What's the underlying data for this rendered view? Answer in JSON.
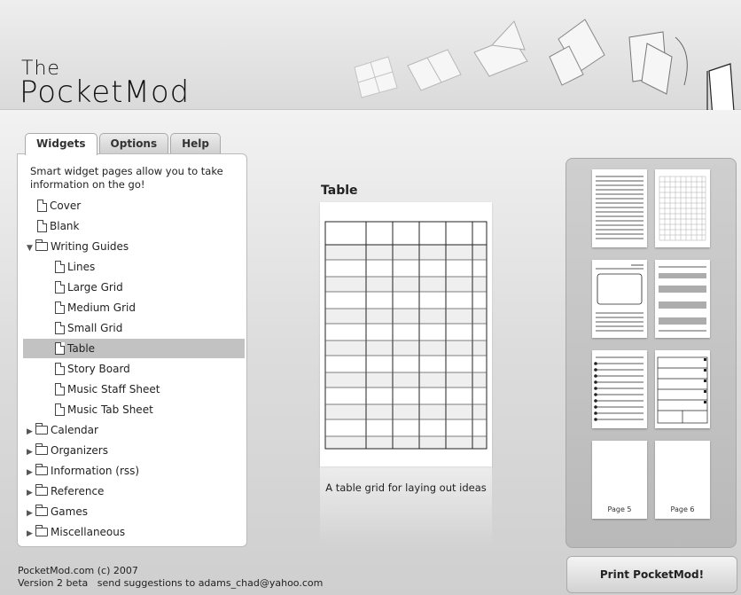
{
  "header": {
    "logo_the": "The",
    "logo_name": "PocketMod"
  },
  "tabs": [
    {
      "label": "Widgets",
      "active": true
    },
    {
      "label": "Options",
      "active": false
    },
    {
      "label": "Help",
      "active": false
    }
  ],
  "sidebar": {
    "intro": "Smart widget pages allow you to take information on the go!",
    "items": [
      {
        "label": "Cover",
        "kind": "page"
      },
      {
        "label": "Blank",
        "kind": "page"
      },
      {
        "label": "Writing Guides",
        "kind": "folder-open"
      },
      {
        "label": "Lines",
        "kind": "page"
      },
      {
        "label": "Large Grid",
        "kind": "page"
      },
      {
        "label": "Medium Grid",
        "kind": "page"
      },
      {
        "label": "Small Grid",
        "kind": "page"
      },
      {
        "label": "Table",
        "kind": "page",
        "selected": true
      },
      {
        "label": "Story Board",
        "kind": "page"
      },
      {
        "label": "Music Staff Sheet",
        "kind": "page"
      },
      {
        "label": "Music Tab Sheet",
        "kind": "page"
      },
      {
        "label": "Calendar",
        "kind": "folder"
      },
      {
        "label": "Organizers",
        "kind": "folder"
      },
      {
        "label": "Information (rss)",
        "kind": "folder"
      },
      {
        "label": "Reference",
        "kind": "folder"
      },
      {
        "label": "Games",
        "kind": "folder"
      },
      {
        "label": "Miscellaneous",
        "kind": "folder"
      }
    ]
  },
  "preview": {
    "title": "Table",
    "caption": "A table grid for laying out ideas"
  },
  "pages": {
    "thumb_kinds": [
      "lines",
      "small-grid",
      "story-board",
      "music-staff",
      "lined-list",
      "organizer",
      "blank",
      "blank"
    ],
    "page5_label": "Page 5",
    "page6_label": "Page 6"
  },
  "print_button": "Print PocketMod!",
  "footer": {
    "line1": "PocketMod.com (c) 2007",
    "line2": "Version 2 beta   send suggestions to adams_chad@yahoo.com"
  },
  "colors": {
    "selected_row": "#c2c2c2",
    "panel_bg": "#c4c4c4"
  }
}
